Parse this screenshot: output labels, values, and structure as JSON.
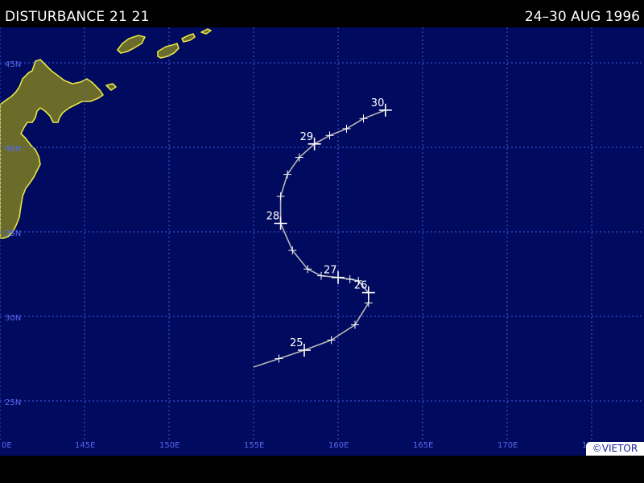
{
  "header": {
    "title": "DISTURBANCE 21 21",
    "date_range": "24–30 AUG 1996"
  },
  "credit": "©VIETOR",
  "map": {
    "lat_labels": [
      "45N",
      "40N",
      "35N",
      "30N",
      "25N"
    ],
    "lon_labels": [
      "0E",
      "145E",
      "150E",
      "155E",
      "160E",
      "165E",
      "170E",
      "175E"
    ],
    "colors": {
      "ocean": "#000a5e",
      "land": "#6b6b2a",
      "coast": "#e5e548",
      "grid": "#4a5ae6",
      "grid_label": "#5a6af0",
      "track": "#b8b8b8",
      "marker": "#ffffff"
    },
    "track_points": [
      {
        "lon": 155.0,
        "lat": 27.0
      },
      {
        "lon": 156.5,
        "lat": 27.5
      },
      {
        "lon": 158.0,
        "lat": 28.0,
        "label": "25"
      },
      {
        "lon": 159.6,
        "lat": 28.6
      },
      {
        "lon": 161.0,
        "lat": 29.5
      },
      {
        "lon": 161.8,
        "lat": 30.8
      },
      {
        "lon": 161.8,
        "lat": 31.4,
        "label": "26"
      },
      {
        "lon": 161.2,
        "lat": 32.1
      },
      {
        "lon": 160.7,
        "lat": 32.2
      },
      {
        "lon": 160.0,
        "lat": 32.3,
        "label": "27"
      },
      {
        "lon": 159.0,
        "lat": 32.4
      },
      {
        "lon": 158.2,
        "lat": 32.8
      },
      {
        "lon": 157.3,
        "lat": 33.9
      },
      {
        "lon": 156.6,
        "lat": 35.5,
        "label": "28"
      },
      {
        "lon": 156.6,
        "lat": 37.1
      },
      {
        "lon": 157.0,
        "lat": 38.4
      },
      {
        "lon": 157.7,
        "lat": 39.4
      },
      {
        "lon": 158.6,
        "lat": 40.2,
        "label": "29"
      },
      {
        "lon": 159.5,
        "lat": 40.7
      },
      {
        "lon": 160.5,
        "lat": 41.1
      },
      {
        "lon": 161.5,
        "lat": 41.7
      },
      {
        "lon": 162.8,
        "lat": 42.2,
        "label": "30"
      }
    ]
  }
}
